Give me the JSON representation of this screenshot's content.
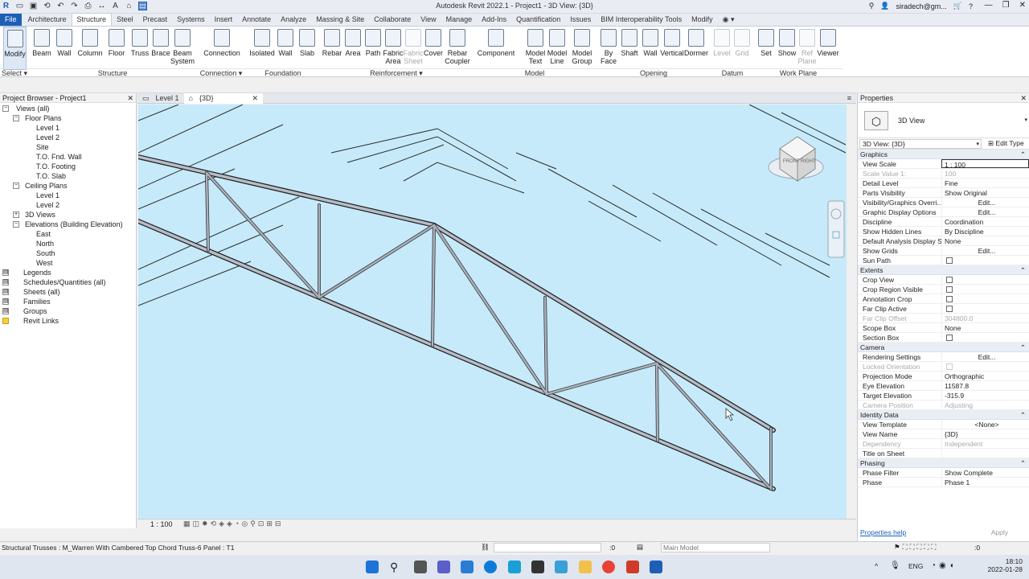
{
  "app_title": "Autodesk Revit 2022.1 - Project1 - 3D View: {3D}",
  "user": "siradech@gm...",
  "tabs": [
    "File",
    "Architecture",
    "Structure",
    "Steel",
    "Precast",
    "Systems",
    "Insert",
    "Annotate",
    "Analyze",
    "Massing & Site",
    "Collaborate",
    "View",
    "Manage",
    "Add-Ins",
    "Quantification",
    "Issues",
    "BIM Interoperability Tools",
    "Modify"
  ],
  "ribbon": {
    "buttons": [
      "Modify",
      "Beam",
      "Wall",
      "Column",
      "Floor",
      "Truss",
      "Brace",
      "Beam System",
      "Connection",
      "Isolated",
      "Wall",
      "Slab",
      "Rebar",
      "Area",
      "Path",
      "Fabric Area",
      "Fabric Sheet",
      "Cover",
      "Rebar Coupler",
      "Component",
      "Model Text",
      "Model Line",
      "Model Group",
      "By Face",
      "Shaft",
      "Wall",
      "Vertical",
      "Dormer",
      "Level",
      "Grid",
      "Set",
      "Show",
      "Ref Plane",
      "Viewer"
    ],
    "panels": [
      "Select ▾",
      "Structure",
      "Connection ▾",
      "Foundation",
      "Reinforcement ▾",
      "Model",
      "Opening",
      "Datum",
      "Work Plane"
    ]
  },
  "project_browser": {
    "title": "Project Browser - Project1",
    "items": [
      "Views (all)",
      "Floor Plans",
      "Level 1",
      "Level 2",
      "Site",
      "T.O. Fnd. Wall",
      "T.O. Footing",
      "T.O. Slab",
      "Ceiling Plans",
      "Level 1",
      "Level 2",
      "3D Views",
      "Elevations (Building Elevation)",
      "East",
      "North",
      "South",
      "West",
      "Legends",
      "Schedules/Quantities (all)",
      "Sheets (all)",
      "Families",
      "Groups",
      "Revit Links"
    ]
  },
  "view_tabs": [
    "Level 1",
    "{3D}"
  ],
  "view_scale": "1 : 100",
  "viewcube": {
    "front": "FRONT",
    "right": "RIGHT"
  },
  "properties": {
    "title": "Properties",
    "type_name": "3D View",
    "selector": "3D View: {3D}",
    "edit_type": "Edit Type",
    "sections": [
      {
        "name": "Graphics",
        "rows": [
          [
            "View Scale",
            "1 : 100"
          ],
          [
            "Scale Value 1:",
            "100"
          ],
          [
            "Detail Level",
            "Fine"
          ],
          [
            "Parts Visibility",
            "Show Original"
          ],
          [
            "Visibility/Graphics Overri...",
            "Edit..."
          ],
          [
            "Graphic Display Options",
            "Edit..."
          ],
          [
            "Discipline",
            "Coordination"
          ],
          [
            "Show Hidden Lines",
            "By Discipline"
          ],
          [
            "Default Analysis Display S...",
            "None"
          ],
          [
            "Show Grids",
            "Edit..."
          ],
          [
            "Sun Path",
            ""
          ]
        ]
      },
      {
        "name": "Extents",
        "rows": [
          [
            "Crop View",
            ""
          ],
          [
            "Crop Region Visible",
            ""
          ],
          [
            "Annotation Crop",
            ""
          ],
          [
            "Far Clip Active",
            ""
          ],
          [
            "Far Clip Offset",
            "304800.0"
          ],
          [
            "Scope Box",
            "None"
          ],
          [
            "Section Box",
            ""
          ]
        ]
      },
      {
        "name": "Camera",
        "rows": [
          [
            "Rendering Settings",
            "Edit..."
          ],
          [
            "Locked Orientation",
            ""
          ],
          [
            "Projection Mode",
            "Orthographic"
          ],
          [
            "Eye Elevation",
            "11587.8"
          ],
          [
            "Target Elevation",
            "-315.9"
          ],
          [
            "Camera Position",
            "Adjusting"
          ]
        ]
      },
      {
        "name": "Identity Data",
        "rows": [
          [
            "View Template",
            "<None>"
          ],
          [
            "View Name",
            "{3D}"
          ],
          [
            "Dependency",
            "Independent"
          ],
          [
            "Title on Sheet",
            ""
          ]
        ]
      },
      {
        "name": "Phasing",
        "rows": [
          [
            "Phase Filter",
            "Show Complete"
          ],
          [
            "Phase",
            "Phase 1"
          ]
        ]
      }
    ],
    "help": "Properties help",
    "apply": "Apply"
  },
  "status": {
    "left": "Structural Trusses : M_Warren With Cambered Top Chord Truss-6 Panel : T1",
    "coord": ":0",
    "model": "Main Model",
    "filter": ":0"
  },
  "taskbar": {
    "lang": "ENG",
    "time": "18:10",
    "date": "2022-01-28"
  }
}
